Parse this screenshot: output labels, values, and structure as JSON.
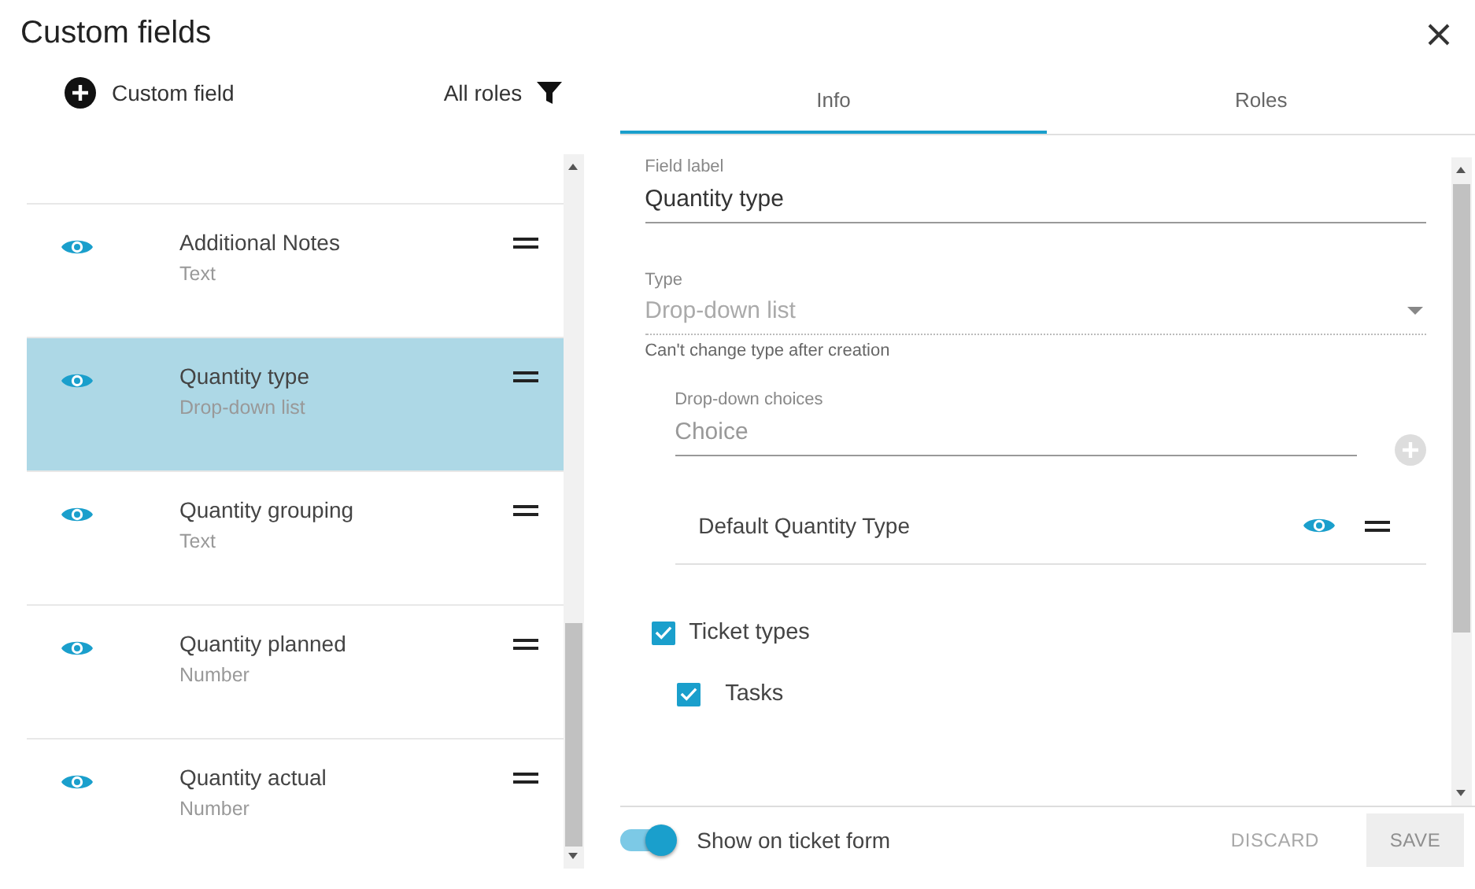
{
  "window": {
    "title": "Custom fields"
  },
  "toolbar": {
    "add_label": "Custom field",
    "filter_label": "All roles"
  },
  "fields": [
    {
      "name": "Additional Notes",
      "type": "Text",
      "selected": false,
      "visible": true
    },
    {
      "name": "Quantity type",
      "type": "Drop-down list",
      "selected": true,
      "visible": true
    },
    {
      "name": "Quantity grouping",
      "type": "Text",
      "selected": false,
      "visible": true
    },
    {
      "name": "Quantity planned",
      "type": "Number",
      "selected": false,
      "visible": true
    },
    {
      "name": "Quantity actual",
      "type": "Number",
      "selected": false,
      "visible": true
    }
  ],
  "tabs": [
    {
      "label": "Info",
      "selected": true
    },
    {
      "label": "Roles",
      "selected": false
    }
  ],
  "form": {
    "field_label": {
      "label": "Field label",
      "value": "Quantity type"
    },
    "type": {
      "label": "Type",
      "value": "Drop-down list",
      "disabled": true,
      "hint": "Can't change type after creation"
    },
    "choices": {
      "label": "Drop-down choices",
      "placeholder": "Choice"
    },
    "choice_items": [
      {
        "name": "Default Quantity Type",
        "visible": true
      }
    ],
    "ticket_types": {
      "label": "Ticket types",
      "checked": true,
      "children": [
        {
          "label": "Tasks",
          "checked": true
        }
      ]
    }
  },
  "footer": {
    "toggle": {
      "label": "Show on ticket form",
      "on": true
    },
    "buttons": [
      {
        "label": "DISCARD",
        "kind": "text",
        "disabled": true
      },
      {
        "label": "SAVE",
        "kind": "filled",
        "disabled": true
      }
    ]
  }
}
